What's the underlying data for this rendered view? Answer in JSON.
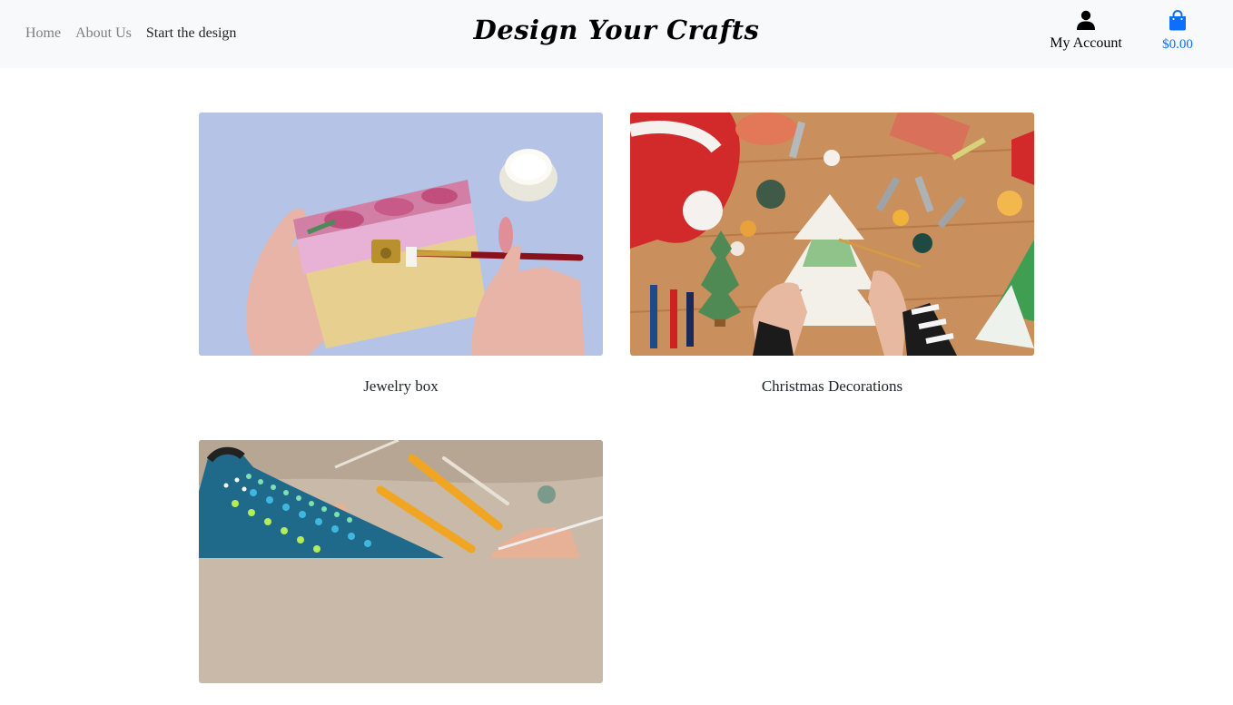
{
  "nav": {
    "links": [
      {
        "label": "Home"
      },
      {
        "label": "About Us"
      },
      {
        "label": "Start the design"
      }
    ],
    "brand": "Design Your Crafts",
    "account_label": "My Account",
    "cart_total": "$0.00"
  },
  "products": [
    {
      "title": "Jewelry box"
    },
    {
      "title": "Christmas Decorations"
    },
    {
      "title": ""
    }
  ],
  "colors": {
    "navbar_bg": "#f8f9fa",
    "link": "#7b7f83",
    "cart": "#0d6efd"
  }
}
